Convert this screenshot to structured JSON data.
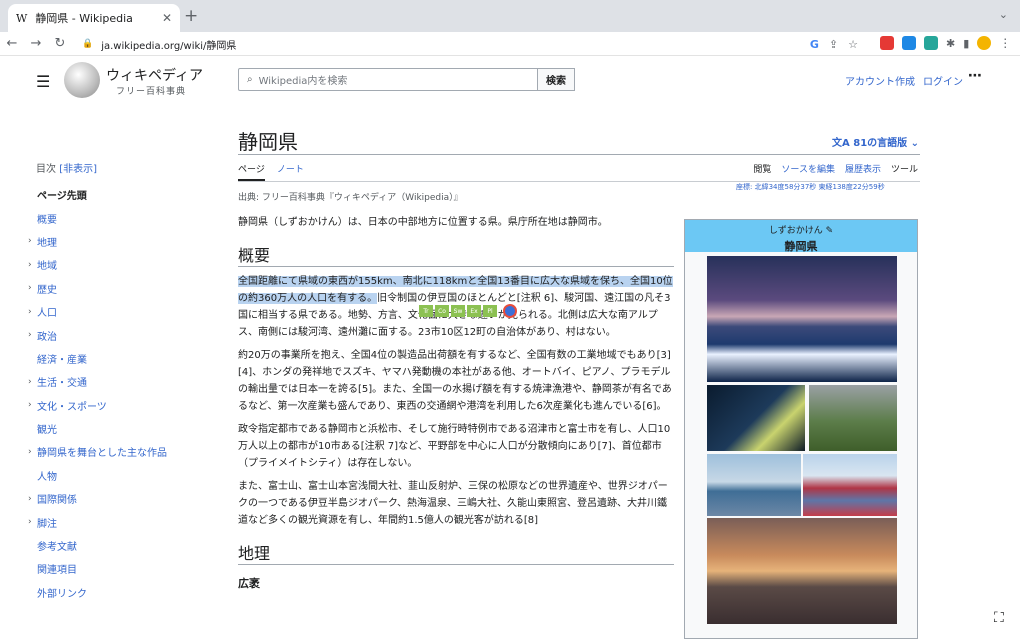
{
  "browser": {
    "tab_title": "静岡県 - Wikipedia",
    "tab_favicon": "W",
    "url": "ja.wikipedia.org/wiki/静岡県"
  },
  "wiki": {
    "site_name": "ウィキペディア",
    "tagline": "フリー百科事典",
    "search_placeholder": "Wikipedia内を検索",
    "search_button": "検索",
    "create_account": "アカウント作成",
    "login": "ログイン"
  },
  "toc": {
    "heading": "目次",
    "hide": "[非表示]",
    "items": [
      {
        "label": "ページ先頭",
        "expandable": false,
        "current": true
      },
      {
        "label": "概要",
        "expandable": false
      },
      {
        "label": "地理",
        "expandable": true
      },
      {
        "label": "地域",
        "expandable": true
      },
      {
        "label": "歴史",
        "expandable": true
      },
      {
        "label": "人口",
        "expandable": true
      },
      {
        "label": "政治",
        "expandable": true
      },
      {
        "label": "経済・産業",
        "expandable": false
      },
      {
        "label": "生活・交通",
        "expandable": true
      },
      {
        "label": "文化・スポーツ",
        "expandable": true
      },
      {
        "label": "観光",
        "expandable": false
      },
      {
        "label": "静岡県を舞台とした主な作品",
        "expandable": true
      },
      {
        "label": "人物",
        "expandable": false
      },
      {
        "label": "国際関係",
        "expandable": true
      },
      {
        "label": "脚注",
        "expandable": true
      },
      {
        "label": "参考文献",
        "expandable": false
      },
      {
        "label": "関連項目",
        "expandable": false
      },
      {
        "label": "外部リンク",
        "expandable": false
      }
    ]
  },
  "article": {
    "title": "静岡県",
    "languages": "81の言語版",
    "tabs_left": [
      "ページ",
      "ノート"
    ],
    "tabs_right": [
      "閲覧",
      "ソースを編集",
      "履歴表示",
      "ツール"
    ],
    "from_line": "出典: フリー百科事典『ウィキペディア（Wikipedia）』",
    "coords": "座標: 北緯34度58分37秒 東経138度22分59秒",
    "intro": "静岡県（しずおかけん）は、日本の中部地方に位置する県。県庁所在地は静岡市。",
    "h_overview": "概要",
    "p1_highlight": "全国距離にて県域の東西が155km、南北に118kmと全国13番目に広大な県域を保ち、全国10位の約360万人の人口を有する。",
    "p1_rest": "旧令制国の伊豆国のほとんどと[注釈 6]、駿河国、遠江国の凡そ3国に相当する県である。地勢、方言、文化面に大きな違いが見られる。北側は広大な南アルプス、南側には駿河湾、遠州灘に面する。23市10区12町の自治体があり、村はない。",
    "p2": "約20万の事業所を抱え、全国4位の製造品出荷額を有するなど、全国有数の工業地域でもあり[3][4]、ホンダの発祥地でスズキ、ヤマハ発動機の本社がある他、オートバイ、ピアノ、プラモデルの輸出量では日本一を誇る[5]。また、全国一の水揚げ額を有する焼津漁港や、静岡茶が有名であるなど、第一次産業も盛んであり、東西の交通網や港湾を利用した6次産業化も進んでいる[6]。",
    "p3": "政令指定都市である静岡市と浜松市、そして施行時特例市である沼津市と富士市を有し、人口10万人以上の都市が10市ある[注釈 7]など、平野部を中心に人口が分散傾向にあり[7]、首位都市（プライメイトシティ）は存在しない。",
    "p4": "また、富士山、富士山本宮浅間大社、韮山反射炉、三保の松原などの世界遺産や、世界ジオパークの一つである伊豆半島ジオパーク、熱海温泉、三嶋大社、久能山東照宮、登呂遺跡、大井川鐵道など多くの観光資源を有し、年間約1.5億人の観光客が訪れる[8]",
    "h_geo": "地理",
    "h_outline": "広袤"
  },
  "infobox": {
    "reading": "しずおかけん",
    "name": "静岡県"
  },
  "translate_toolbar": [
    "Tr",
    "Co",
    "Sw",
    "Ex",
    "Pl"
  ]
}
